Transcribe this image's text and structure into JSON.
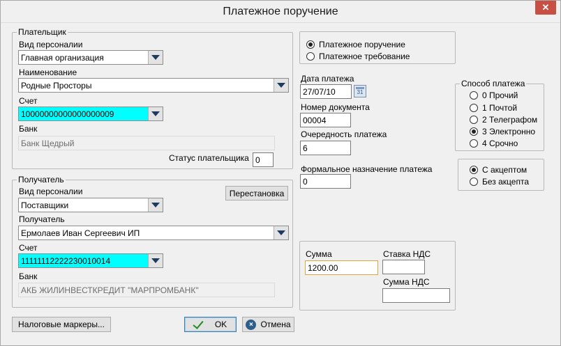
{
  "window": {
    "title": "Платежное поручение",
    "close_glyph": "✕"
  },
  "payer": {
    "legend": "Плательщик",
    "personnel_label": "Вид персоналии",
    "personnel_value": "Главная организация",
    "name_label": "Наименование",
    "name_value": "Родные Просторы",
    "account_label": "Счет",
    "account_value": "10000000000000000009",
    "bank_label": "Банк",
    "bank_value": "Банк Щедрый",
    "status_label": "Статус плательщика",
    "status_value": "0"
  },
  "recipient": {
    "legend": "Получатель",
    "personnel_label": "Вид персоналии",
    "personnel_value": "Поставщики",
    "swap_button": "Перестановка",
    "name_label": "Получатель",
    "name_value": "Ермолаев Иван Сергеевич ИП",
    "account_label": "Счет",
    "account_value": "11111112222230010014",
    "bank_label": "Банк",
    "bank_value": "АКБ ЖИЛИНВЕСТКРЕДИТ \"МАРПРОМБАНК\""
  },
  "doc_type": {
    "options": [
      "Платежное поручение",
      "Платежное требование"
    ],
    "selected": 0
  },
  "payment_date": {
    "label": "Дата платежа",
    "value": "27/07/10",
    "calendar_icon_text": "31"
  },
  "doc_number": {
    "label": "Номер документа",
    "value": "00004"
  },
  "priority": {
    "label": "Очередность платежа",
    "value": "6"
  },
  "purpose": {
    "label": "Формальное назначение платежа",
    "value": "0"
  },
  "payment_method": {
    "legend": "Способ платежа",
    "options": [
      "0 Прочий",
      "1 Почтой",
      "2 Телеграфом",
      "3 Электронно",
      "4 Срочно"
    ],
    "selected": 3
  },
  "acceptance": {
    "options": [
      "С акцептом",
      "Без акцепта"
    ],
    "selected": 0
  },
  "amount": {
    "sum_label": "Сумма",
    "sum_value": "1200.00",
    "vat_rate_label": "Ставка НДС",
    "vat_rate_value": "",
    "vat_sum_label": "Сумма НДС",
    "vat_sum_value": ""
  },
  "buttons": {
    "tax_markers": "Налоговые маркеры...",
    "ok": "OK",
    "cancel": "Отмена"
  },
  "colors": {
    "account_highlight": "#00ffff",
    "close_button": "#c74f43",
    "focus_border": "#e8a33a"
  }
}
